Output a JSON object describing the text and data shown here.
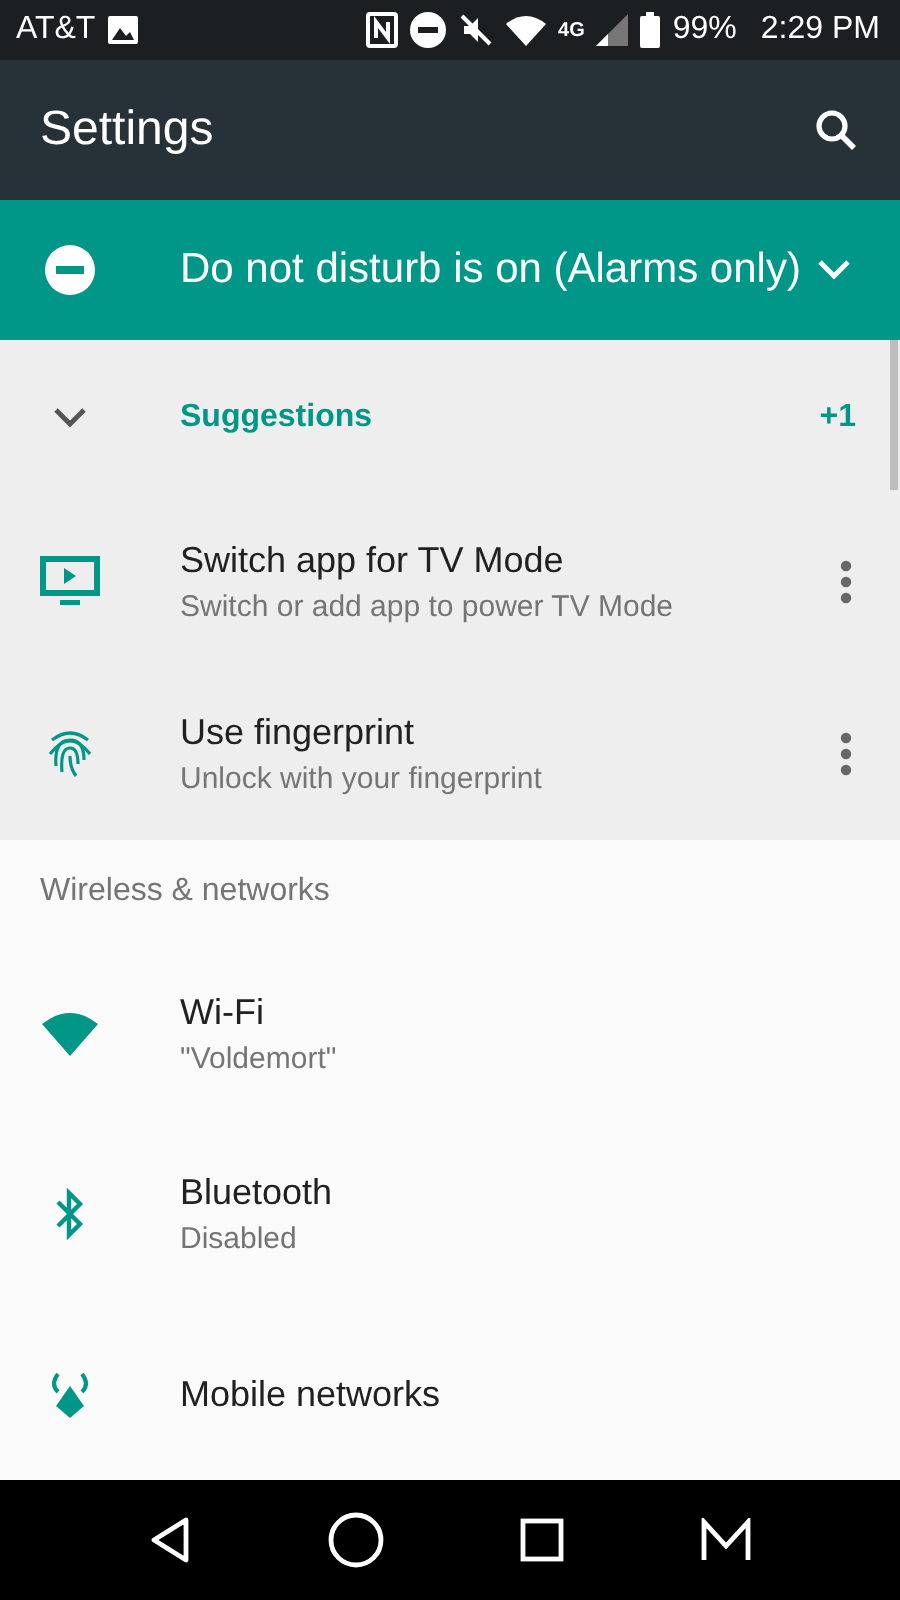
{
  "status_bar": {
    "carrier": "AT&T",
    "network": "4G",
    "battery": "99%",
    "time": "2:29 PM"
  },
  "toolbar": {
    "title": "Settings"
  },
  "dnd_banner": {
    "text": "Do not disturb is on (Alarms only)",
    "expanded": false
  },
  "suggestions": {
    "title": "Suggestions",
    "count": "+1",
    "expanded": true,
    "items": [
      {
        "kind": "tv",
        "title": "Switch app for TV Mode",
        "subtitle": "Switch or add app to power TV Mode"
      },
      {
        "kind": "fingerprint",
        "title": "Use fingerprint",
        "subtitle": "Unlock with your fingerprint"
      }
    ]
  },
  "section": {
    "title": "Wireless & networks",
    "items": [
      {
        "kind": "wifi",
        "title": "Wi-Fi",
        "subtitle": "\"Voldemort\""
      },
      {
        "kind": "bluetooth",
        "title": "Bluetooth",
        "subtitle": "Disabled"
      },
      {
        "kind": "mobile",
        "title": "Mobile networks"
      }
    ]
  }
}
